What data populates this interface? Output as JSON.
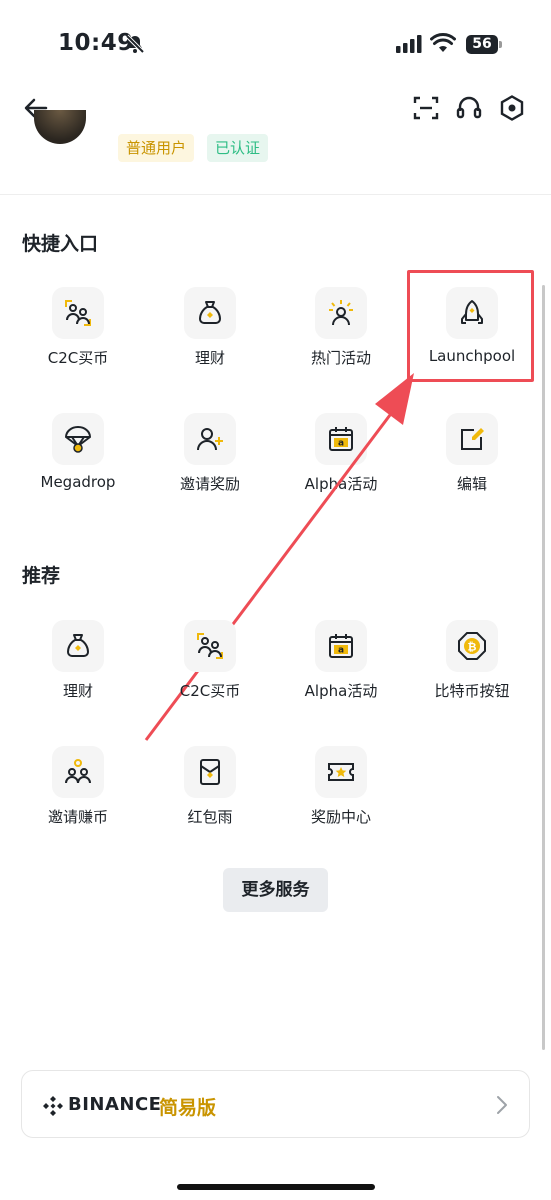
{
  "status_bar": {
    "time": "10:49",
    "battery": "56"
  },
  "profile": {
    "badges": [
      {
        "label": "普通用户",
        "color": "#c99400"
      },
      {
        "label": "已认证",
        "color": "#2ebd85"
      }
    ]
  },
  "quick_access": {
    "title": "快捷入口",
    "items": [
      {
        "label": "C2C买币",
        "icon": "c2c-icon"
      },
      {
        "label": "理财",
        "icon": "earn-bag-icon"
      },
      {
        "label": "热门活动",
        "icon": "hot-activity-icon"
      },
      {
        "label": "Launchpool",
        "icon": "rocket-icon",
        "highlighted": true
      },
      {
        "label": "Megadrop",
        "icon": "parachute-icon"
      },
      {
        "label": "邀请奖励",
        "icon": "invite-user-icon"
      },
      {
        "label": "Alpha活动",
        "icon": "alpha-calendar-icon"
      },
      {
        "label": "编辑",
        "icon": "edit-icon"
      }
    ]
  },
  "recommended": {
    "title": "推荐",
    "items": [
      {
        "label": "理财",
        "icon": "earn-bag-icon"
      },
      {
        "label": "C2C买币",
        "icon": "c2c-icon"
      },
      {
        "label": "Alpha活动",
        "icon": "alpha-calendar-icon"
      },
      {
        "label": "比特币按钮",
        "icon": "bitcoin-button-icon"
      },
      {
        "label": "邀请赚币",
        "icon": "invite-earn-icon"
      },
      {
        "label": "红包雨",
        "icon": "red-packet-icon"
      },
      {
        "label": "奖励中心",
        "icon": "reward-ticket-icon"
      }
    ]
  },
  "more_services": {
    "label": "更多服务"
  },
  "lite_banner": {
    "brand": "BINANCE",
    "mode": "简易版"
  },
  "colors": {
    "accent": "#f0b90b",
    "annotation": "#ee4c55",
    "text": "#1e2329"
  }
}
